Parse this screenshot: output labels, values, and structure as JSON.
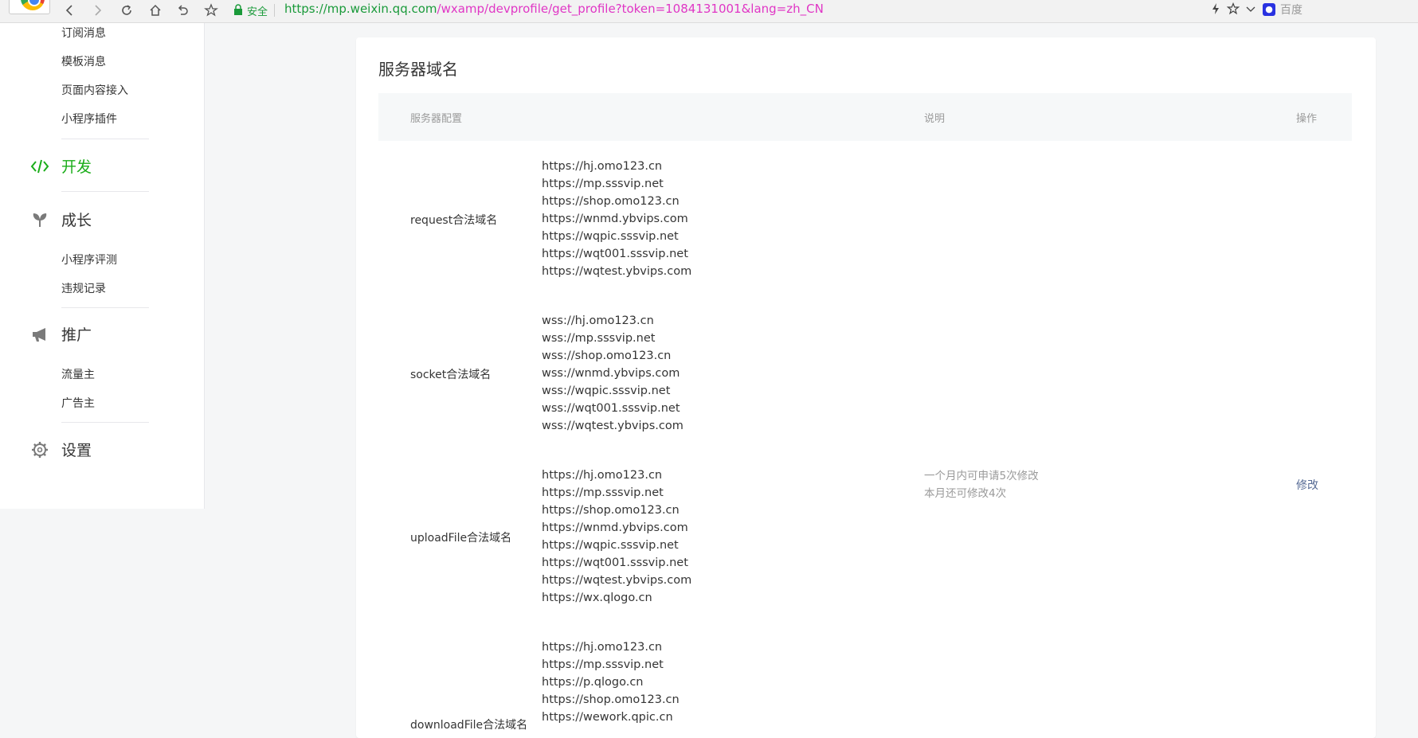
{
  "browser": {
    "secure_label": "安全",
    "url_https": "https://",
    "url_host": "mp.weixin.qq.com",
    "url_path": "/wxamp/devprofile/get_profile?token=1084131001&lang=zh_CN",
    "search_engine": "百度"
  },
  "sidebar": {
    "top_items": [
      {
        "label": "订阅消息"
      },
      {
        "label": "模板消息"
      },
      {
        "label": "页面内容接入"
      },
      {
        "label": "小程序插件"
      }
    ],
    "groups": [
      {
        "label": "开发",
        "icon": "code-icon",
        "active": true
      },
      {
        "label": "成长",
        "icon": "sprout-icon",
        "items": [
          "小程序评测",
          "违规记录"
        ]
      },
      {
        "label": "推广",
        "icon": "megaphone-icon",
        "items": [
          "流量主",
          "广告主"
        ]
      },
      {
        "label": "设置",
        "icon": "gear-icon"
      }
    ],
    "growth_items": [
      "小程序评测",
      "违规记录"
    ],
    "promo_items": [
      "流量主",
      "广告主"
    ]
  },
  "main": {
    "title": "服务器域名",
    "columns": [
      "服务器配置",
      "说明",
      "操作"
    ],
    "rows": [
      {
        "label": "request合法域名",
        "domains": [
          "https://hj.omo123.cn",
          "https://mp.sssvip.net",
          "https://shop.omo123.cn",
          "https://wnmd.ybvips.com",
          "https://wqpic.sssvip.net",
          "https://wqt001.sssvip.net",
          "https://wqtest.ybvips.com"
        ]
      },
      {
        "label": "socket合法域名",
        "domains": [
          "wss://hj.omo123.cn",
          "wss://mp.sssvip.net",
          "wss://shop.omo123.cn",
          "wss://wnmd.ybvips.com",
          "wss://wqpic.sssvip.net",
          "wss://wqt001.sssvip.net",
          "wss://wqtest.ybvips.com"
        ]
      },
      {
        "label": "uploadFile合法域名",
        "domains": [
          "https://hj.omo123.cn",
          "https://mp.sssvip.net",
          "https://shop.omo123.cn",
          "https://wnmd.ybvips.com",
          "https://wqpic.sssvip.net",
          "https://wqt001.sssvip.net",
          "https://wqtest.ybvips.com",
          "https://wx.qlogo.cn"
        ]
      },
      {
        "label": "downloadFile合法域名",
        "domains": [
          "https://hj.omo123.cn",
          "https://mp.sssvip.net",
          "https://p.qlogo.cn",
          "https://shop.omo123.cn",
          "https://wework.qpic.cn"
        ]
      }
    ],
    "note_line1": "一个月内可申请5次修改",
    "note_line2": "本月还可修改4次",
    "modify_label": "修改"
  },
  "colors": {
    "accent_green": "#1aad19",
    "link_blue": "#576b95",
    "url_pink": "#e036c5"
  }
}
